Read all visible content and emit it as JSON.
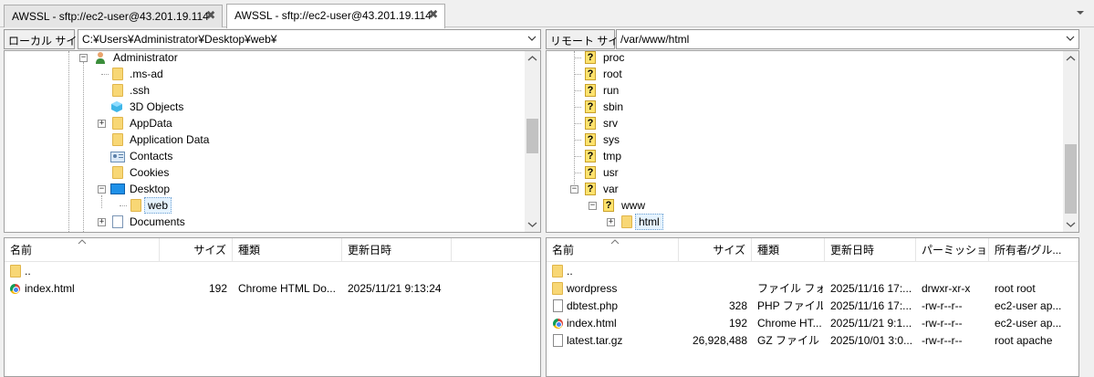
{
  "tabs": [
    {
      "label": "AWSSL - sftp://ec2-user@43.201.19.114",
      "active": false
    },
    {
      "label": "AWSSL - sftp://ec2-user@43.201.19.114",
      "active": true
    }
  ],
  "local": {
    "site_label": "ローカル サイト:",
    "path": "C:¥Users¥Administrator¥Desktop¥web¥",
    "tree": [
      {
        "label": "Administrator",
        "icon": "user-icon"
      },
      {
        "label": ".ms-ad",
        "icon": "folder-icon"
      },
      {
        "label": ".ssh",
        "icon": "folder-icon"
      },
      {
        "label": "3D Objects",
        "icon": "3d-objects-icon"
      },
      {
        "label": "AppData",
        "icon": "folder-icon"
      },
      {
        "label": "Application Data",
        "icon": "shortcut-folder-icon"
      },
      {
        "label": "Contacts",
        "icon": "contacts-icon"
      },
      {
        "label": "Cookies",
        "icon": "shortcut-folder-icon"
      },
      {
        "label": "Desktop",
        "icon": "desktop-icon"
      },
      {
        "label": "web",
        "icon": "folder-icon"
      },
      {
        "label": "Documents",
        "icon": "documents-icon"
      }
    ],
    "columns": [
      "名前",
      "サイズ",
      "種類",
      "更新日時"
    ],
    "files": [
      {
        "name": "..",
        "size": "",
        "type": "",
        "modified": "",
        "icon": "folder-icon"
      },
      {
        "name": "index.html",
        "size": "192",
        "type": "Chrome HTML Do...",
        "modified": "2025/11/21 9:13:24",
        "icon": "chrome-icon"
      }
    ]
  },
  "remote": {
    "site_label": "リモート サイト:",
    "path": "/var/www/html",
    "tree": [
      {
        "label": "proc"
      },
      {
        "label": "root"
      },
      {
        "label": "run"
      },
      {
        "label": "sbin"
      },
      {
        "label": "srv"
      },
      {
        "label": "sys"
      },
      {
        "label": "tmp"
      },
      {
        "label": "usr"
      },
      {
        "label": "var"
      },
      {
        "label": "www"
      },
      {
        "label": "html"
      }
    ],
    "columns": [
      "名前",
      "サイズ",
      "種類",
      "更新日時",
      "パーミッション",
      "所有者/グル..."
    ],
    "files": [
      {
        "name": "..",
        "size": "",
        "type": "",
        "modified": "",
        "perm": "",
        "owner": "",
        "icon": "folder-icon"
      },
      {
        "name": "wordpress",
        "size": "",
        "type": "ファイル フォ...",
        "modified": "2025/11/16 17:...",
        "perm": "drwxr-xr-x",
        "owner": "root root",
        "icon": "folder-icon"
      },
      {
        "name": "dbtest.php",
        "size": "328",
        "type": "PHP ファイル",
        "modified": "2025/11/16 17:...",
        "perm": "-rw-r--r--",
        "owner": "ec2-user ap...",
        "icon": "file-icon"
      },
      {
        "name": "index.html",
        "size": "192",
        "type": "Chrome HT...",
        "modified": "2025/11/21 9:1...",
        "perm": "-rw-r--r--",
        "owner": "ec2-user ap...",
        "icon": "chrome-icon"
      },
      {
        "name": "latest.tar.gz",
        "size": "26,928,488",
        "type": "GZ ファイル",
        "modified": "2025/10/01 3:0...",
        "perm": "-rw-r--r--",
        "owner": "root apache",
        "icon": "file-icon"
      }
    ]
  }
}
